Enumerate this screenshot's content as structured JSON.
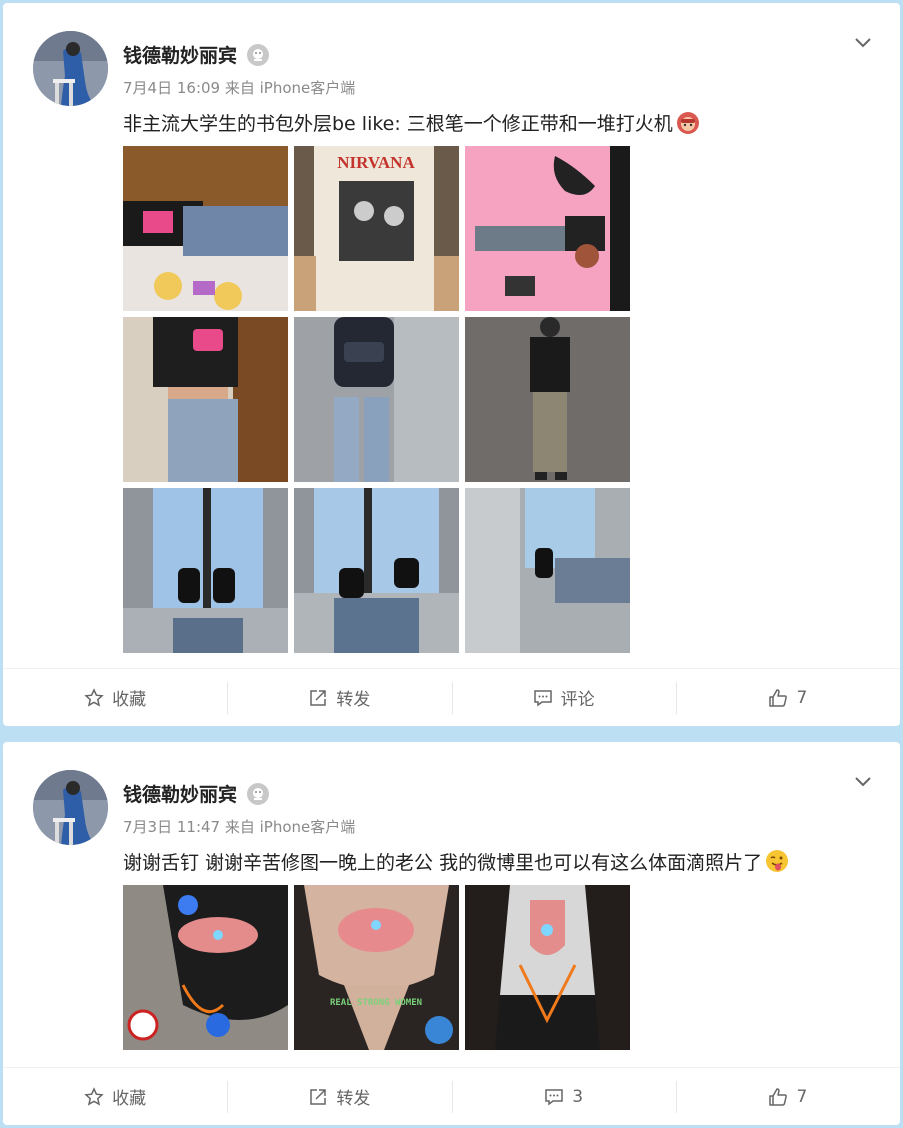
{
  "posts": [
    {
      "author": "钱德勒妙丽宾",
      "meta": "7月4日 16:09 来自 iPhone客户端",
      "text": "非主流大学生的书包外层be like: 三根笔一个修正带和一堆打火机",
      "emoji_icon": "monkey-emoji-icon",
      "images": [
        {
          "name": "photo-tshirt-lying",
          "overlay": ""
        },
        {
          "name": "photo-nirvana-tee",
          "overlay": "NIRVANA"
        },
        {
          "name": "photo-pink-wall",
          "overlay": ""
        },
        {
          "name": "photo-heart-hands",
          "overlay": ""
        },
        {
          "name": "photo-backpack",
          "overlay": ""
        },
        {
          "name": "photo-tank-top",
          "overlay": ""
        },
        {
          "name": "photo-window-feet-1",
          "overlay": ""
        },
        {
          "name": "photo-window-feet-2",
          "overlay": ""
        },
        {
          "name": "photo-window-feet-3",
          "overlay": ""
        }
      ],
      "actions": {
        "favorite": "收藏",
        "repost": "转发",
        "comment": "评论",
        "like": "7"
      }
    },
    {
      "author": "钱德勒妙丽宾",
      "meta": "7月3日 11:47 来自 iPhone客户端",
      "text": "谢谢舌钉 谢谢辛苦修图一晚上的老公 我的微博里也可以有这么体面滴照片了",
      "emoji_icon": "tongue-wink-emoji-icon",
      "images": [
        {
          "name": "photo-tongue-1",
          "overlay": ""
        },
        {
          "name": "photo-tongue-2",
          "overlay": "REAL STRONG WOMEN"
        },
        {
          "name": "photo-tongue-3",
          "overlay": ""
        }
      ],
      "actions": {
        "favorite": "收藏",
        "repost": "转发",
        "comment": "3",
        "like": "7"
      }
    }
  ],
  "colors": {
    "background": "#bcdff3",
    "card": "#ffffff",
    "accent_pink": "#f5a3c0"
  }
}
